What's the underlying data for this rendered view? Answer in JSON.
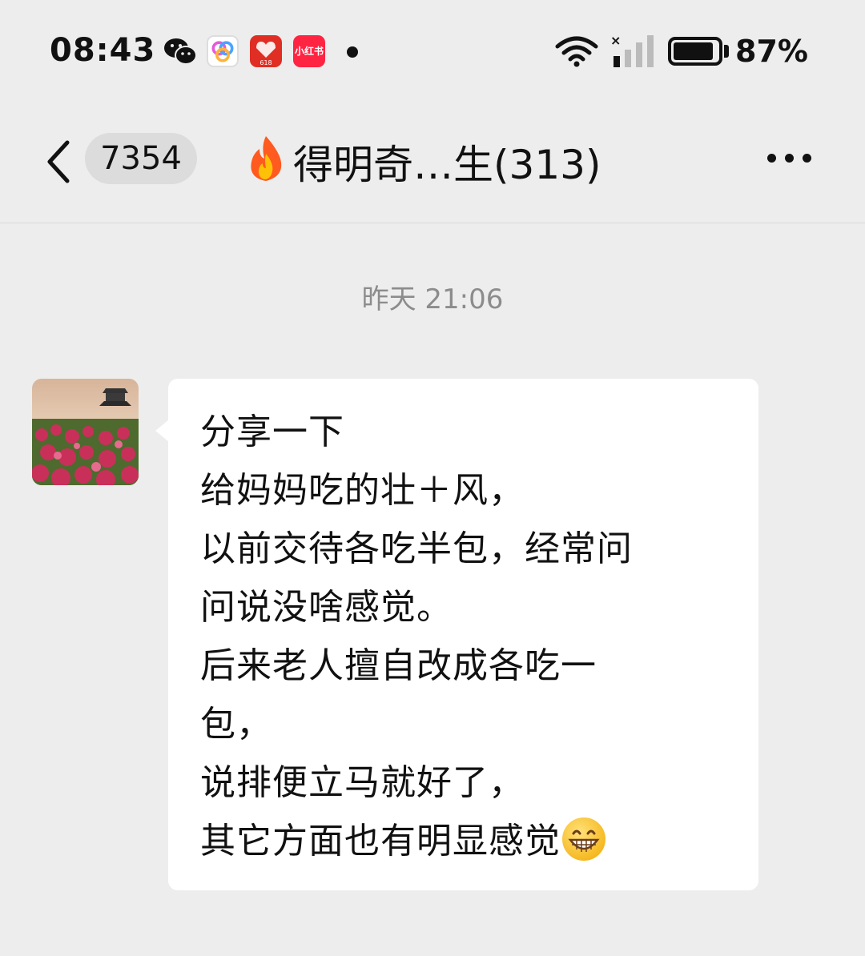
{
  "status_bar": {
    "time": "08:43",
    "xhs_label": "小红书",
    "pdd_label": "618",
    "battery": "87%",
    "notification_icons": [
      "wechat-icon",
      "app-icon",
      "pinduoduo-icon",
      "xiaohongshu-icon",
      "dot-icon"
    ],
    "system_icons": [
      "wifi-icon",
      "signal-icon",
      "battery-icon"
    ]
  },
  "header": {
    "back_icon": "chevron-left-icon",
    "unread_count": "7354",
    "title": "得明奇…生(313)",
    "more_icon": "more-dots-icon"
  },
  "chat": {
    "timestamp": "昨天 21:06",
    "messages": [
      {
        "sender": "other",
        "text": "分享一下\n给妈妈吃的壮＋风，\n以前交待各吃半包，经常问\n问说没啥感觉。\n后来老人擅自改成各吃一\n包，\n说排便立马就好了，\n其它方面也有明显感觉",
        "trailing_emoji": "grinning-face-icon"
      }
    ]
  },
  "colors": {
    "background": "#ededed",
    "bubble": "#ffffff",
    "timestamp": "#8c8c8c",
    "badge": "#dcdcdc"
  }
}
